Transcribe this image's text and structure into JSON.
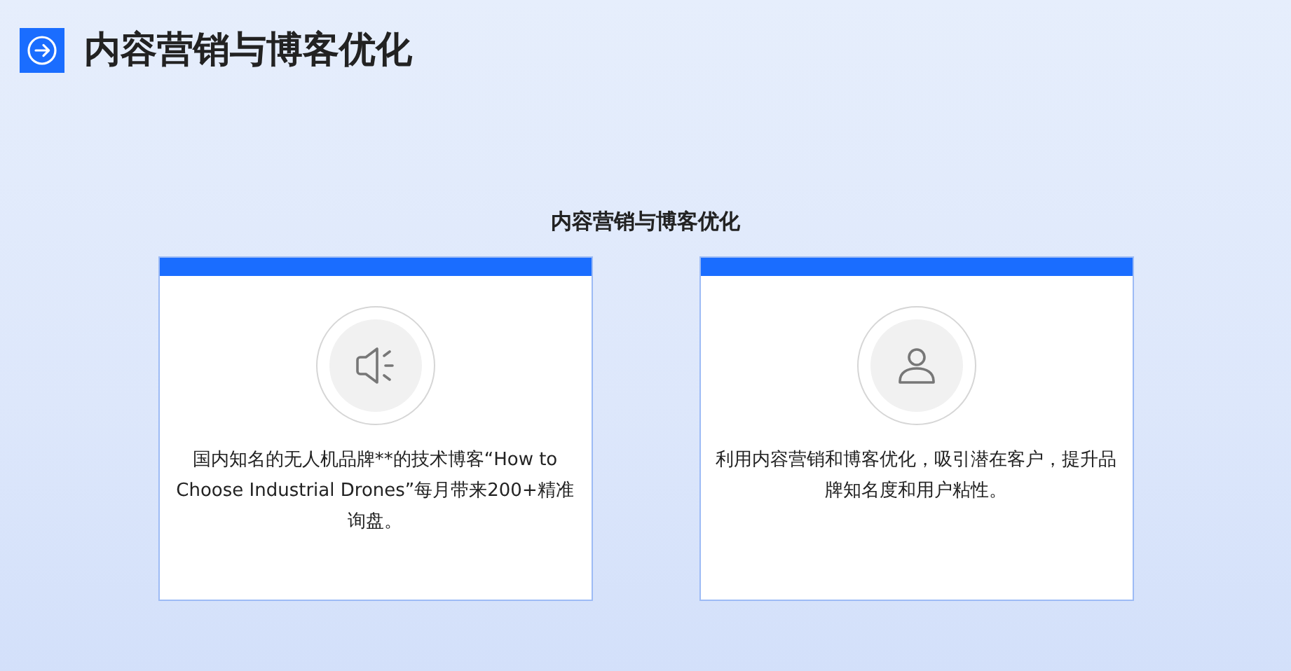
{
  "header": {
    "title": "内容营销与博客优化"
  },
  "section": {
    "title": "内容营销与博客优化"
  },
  "cards": [
    {
      "kind": "speaker",
      "text": "国内知名的无人机品牌**的技术博客“How to Choose Industrial Drones”每月带来200+精准询盘。"
    },
    {
      "kind": "person",
      "text": "利用内容营销和博客优化，吸引潜在客户，提升品牌知名度和用户粘性。"
    }
  ]
}
